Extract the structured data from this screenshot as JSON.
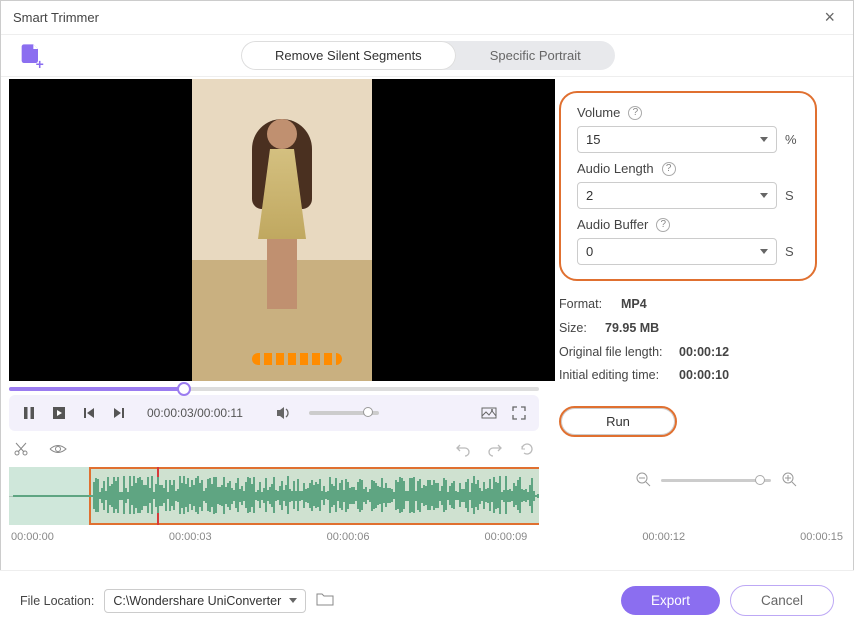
{
  "window": {
    "title": "Smart Trimmer"
  },
  "tabs": {
    "remove_silent": "Remove Silent Segments",
    "specific_portrait": "Specific Portrait"
  },
  "playback": {
    "current": "00:00:03",
    "total": "00:00:11"
  },
  "params": {
    "volume_label": "Volume",
    "volume_value": "15",
    "volume_unit": "%",
    "audio_length_label": "Audio Length",
    "audio_length_value": "2",
    "audio_length_unit": "S",
    "audio_buffer_label": "Audio Buffer",
    "audio_buffer_value": "0",
    "audio_buffer_unit": "S"
  },
  "info": {
    "format_label": "Format:",
    "format_value": "MP4",
    "size_label": "Size:",
    "size_value": "79.95 MB",
    "orig_len_label": "Original file length:",
    "orig_len_value": "00:00:12",
    "init_time_label": "Initial editing time:",
    "init_time_value": "00:00:10"
  },
  "run_label": "Run",
  "ruler": [
    "00:00:00",
    "00:00:03",
    "00:00:06",
    "00:00:09",
    "00:00:12",
    "00:00:15"
  ],
  "footer": {
    "file_location_label": "File Location:",
    "file_location_value": "C:\\Wondershare UniConverter",
    "export_label": "Export",
    "cancel_label": "Cancel"
  },
  "colors": {
    "accent": "#8b6ef0",
    "highlight": "#e07030"
  }
}
